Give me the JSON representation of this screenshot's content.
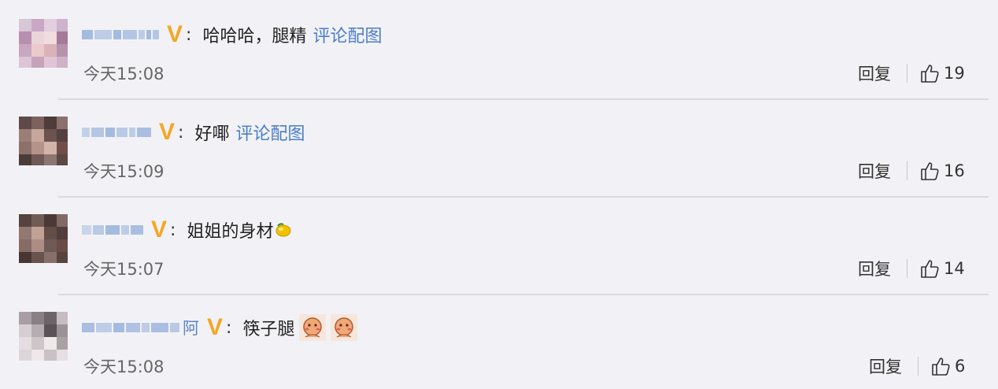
{
  "comments": [
    {
      "vip_mark": "V",
      "colon": ":",
      "text": "哈哈哈，腿精",
      "link": "评论配图",
      "time": "今天15:08",
      "reply": "回复",
      "likes": "19"
    },
    {
      "vip_mark": "V",
      "colon": ":",
      "text": "好㖿",
      "link": "评论配图",
      "time": "今天15:09",
      "reply": "回复",
      "likes": "16"
    },
    {
      "vip_mark": "V",
      "colon": ":",
      "text": "姐姐的身材",
      "emoji": "lemon-emoji",
      "time": "今天15:07",
      "reply": "回复",
      "likes": "14"
    },
    {
      "username_tail": "阿",
      "vip_mark": "V",
      "colon": ":",
      "text": "筷子腿",
      "stickers": [
        "blush-sticker",
        "blush-sticker"
      ],
      "time": "今天15:08",
      "reply": "回复",
      "likes": "6"
    }
  ],
  "colors": {
    "background": "#f2f2f6",
    "link": "#4a7ec8",
    "vip": "#f5a623",
    "meta_text": "#666666"
  }
}
